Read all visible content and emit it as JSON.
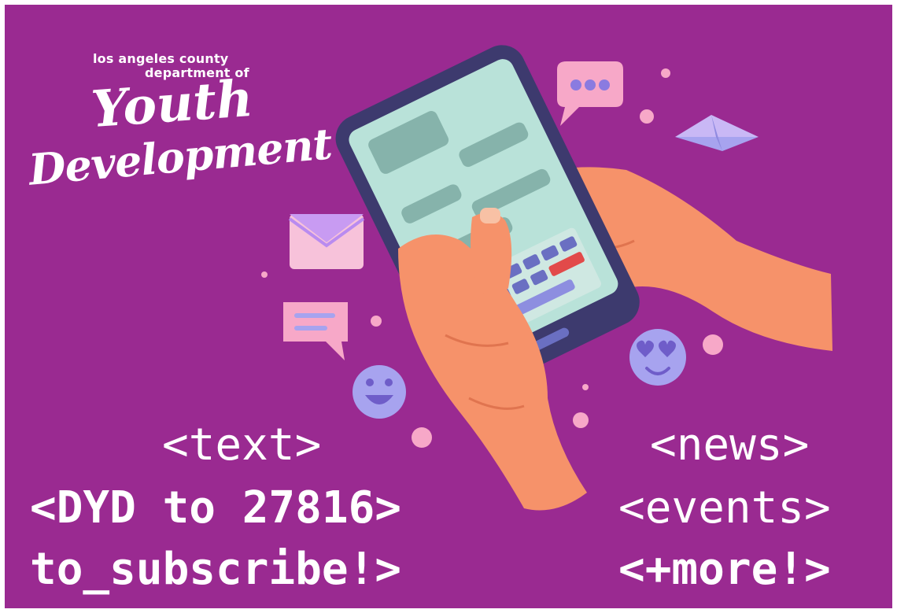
{
  "logo": {
    "line1": "los angeles county",
    "line2": "department of",
    "line3": "Youth",
    "line4": "Development"
  },
  "captions": {
    "left_line1": "<text>",
    "left_line2": "<DYD to 27816>",
    "left_line3": "to_subscribe!>",
    "right_line1": "<news>",
    "right_line2": "<events>",
    "right_line3": "<+more!>"
  },
  "colors": {
    "background": "#9a2a91",
    "text": "#ffffff",
    "skin": "#f6926a",
    "phone_body": "#3d3a6e",
    "phone_screen": "#b9e2d9",
    "bubble_pink": "#f7a8c8",
    "bubble_lavender": "#a7a3ef"
  },
  "icons": [
    "envelope-icon",
    "chat-bubble-icon",
    "smiley-icon",
    "heart-eyes-icon",
    "paper-plane-icon",
    "typing-bubble-icon"
  ]
}
